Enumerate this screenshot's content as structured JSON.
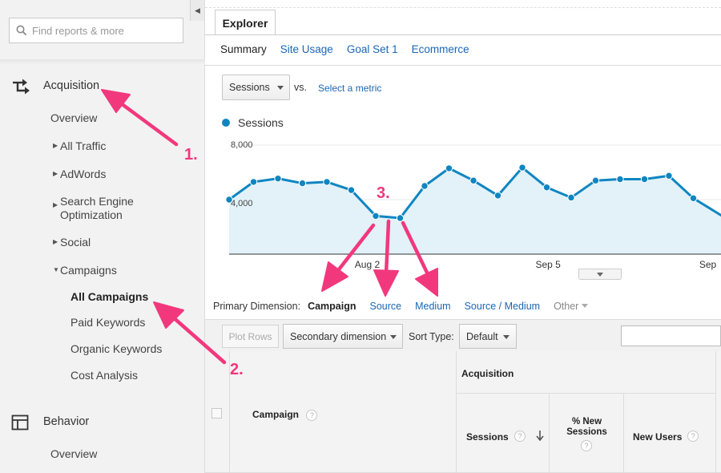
{
  "sidebar": {
    "search_placeholder": "Find reports & more",
    "collapse_icon": "chevron-left-icon",
    "acquisition": {
      "label": "Acquisition",
      "icon": "acquisition-arrows-icon",
      "overview": "Overview",
      "children": [
        {
          "label": "All Traffic"
        },
        {
          "label": "AdWords"
        },
        {
          "label": "Search Engine\nOptimization"
        },
        {
          "label": "Social"
        }
      ],
      "campaigns": {
        "label": "Campaigns",
        "items": [
          "All Campaigns",
          "Paid Keywords",
          "Organic Keywords",
          "Cost Analysis"
        ],
        "active": "All Campaigns"
      }
    },
    "behavior": {
      "label": "Behavior",
      "icon": "behavior-layout-icon",
      "overview": "Overview"
    }
  },
  "main": {
    "tab": "Explorer",
    "subtabs": [
      "Summary",
      "Site Usage",
      "Goal Set 1",
      "Ecommerce"
    ],
    "active_subtab": "Summary",
    "metric_select": "Sessions",
    "vs_label": "vs.",
    "select_metric": "Select a metric",
    "legend_label": "Sessions",
    "primary_dimension_label": "Primary Dimension:",
    "dimensions": [
      "Campaign",
      "Source",
      "Medium",
      "Source / Medium",
      "Other"
    ],
    "active_dimension": "Campaign",
    "toolbar": {
      "plot_rows": "Plot Rows",
      "secondary_dimension": "Secondary dimension",
      "sort_type_label": "Sort Type:",
      "sort_type_value": "Default",
      "search_value": ""
    },
    "table": {
      "campaign_header": "Campaign",
      "acquisition_header": "Acquisition",
      "sessions_header": "Sessions",
      "new_sessions_header": "% New\nSessions",
      "new_users_header": "New Users",
      "help_glyph": "?"
    }
  },
  "annotations": {
    "step1": "1.",
    "step2": "2.",
    "step3": "3.",
    "color": "#f2387d"
  },
  "colors": {
    "accent_blue": "#0f86c1",
    "link_blue": "#1a66b5",
    "area_fill": "#e3f1f9"
  },
  "chart_data": {
    "type": "area",
    "series": [
      {
        "name": "Sessions",
        "values": [
          4000,
          5300,
          5550,
          5200,
          5300,
          4700,
          2800,
          2650,
          5000,
          6300,
          5400,
          4300,
          6350,
          4900,
          4150,
          5400,
          5500,
          5500,
          5750,
          4100,
          3000
        ]
      }
    ],
    "y_ticks": [
      "8,000",
      "4,000"
    ],
    "y_tick_values": [
      8000,
      4000
    ],
    "ylim": [
      0,
      8000
    ],
    "x_ticks": [
      {
        "index": 5.6,
        "label": "Aug 2"
      },
      {
        "index": 13.0,
        "label": "Sep 5"
      },
      {
        "index": 19.7,
        "label": "Sep"
      }
    ],
    "visible_x_range": [
      0,
      20.35
    ]
  }
}
